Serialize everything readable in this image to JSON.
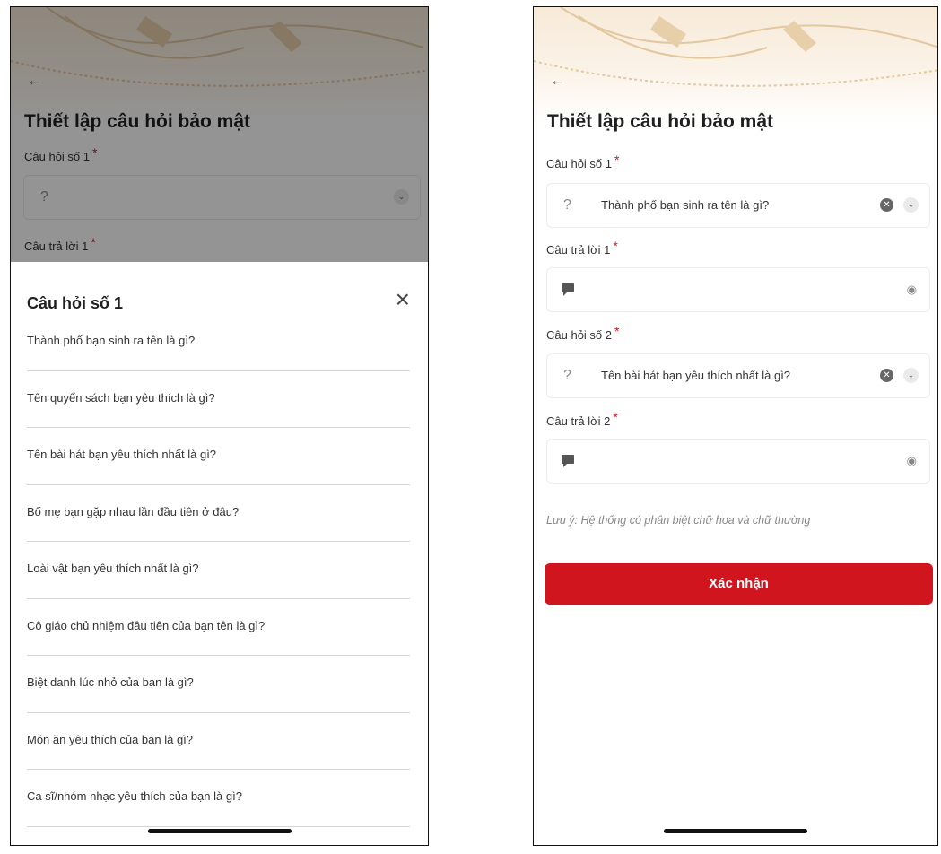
{
  "left": {
    "page_title": "Thiết lập câu hỏi bảo mật",
    "back_icon": "←",
    "q1_label": "Câu hỏi số 1",
    "q1_placeholder": "?",
    "a1_label": "Câu trả lời 1",
    "required_mark": "*",
    "sheet": {
      "title": "Câu hỏi số 1",
      "close_icon": "×",
      "options": [
        "Thành phố bạn sinh ra tên là gì?",
        "Tên quyển sách bạn yêu thích là gì?",
        "Tên bài hát bạn yêu thích nhất là gì?",
        "Bố mẹ bạn gặp nhau lần đầu tiên ở đâu?",
        "Loài vật bạn yêu thích nhất là gì?",
        "Cô giáo chủ nhiệm đầu tiên của bạn tên là gì?",
        "Biệt danh lúc nhỏ của bạn là gì?",
        "Món ăn yêu thích của bạn là gì?",
        "Ca sĩ/nhóm nhạc yêu thích của bạn là gì?"
      ]
    }
  },
  "right": {
    "page_title": "Thiết lập câu hỏi bảo mật",
    "back_icon": "←",
    "required_mark": "*",
    "q1_label": "Câu hỏi số 1",
    "q1_value": "Thành phố bạn sinh ra tên là gì?",
    "a1_label": "Câu trả lời 1",
    "q2_label": "Câu hỏi số 2",
    "q2_value": "Tên bài hát bạn yêu thích nhất là gì?",
    "a2_label": "Câu trả lời 2",
    "q_mark": "?",
    "note": "Lưu ý: Hệ thống có phân biệt chữ hoa và chữ thường",
    "confirm_label": "Xác nhận"
  },
  "colors": {
    "accent": "#d0151e",
    "header_tint": "#f7ead8"
  },
  "icons": [
    "back-arrow-icon",
    "chevron-down-icon",
    "clear-icon",
    "close-icon",
    "chat-icon",
    "eye-off-icon"
  ]
}
